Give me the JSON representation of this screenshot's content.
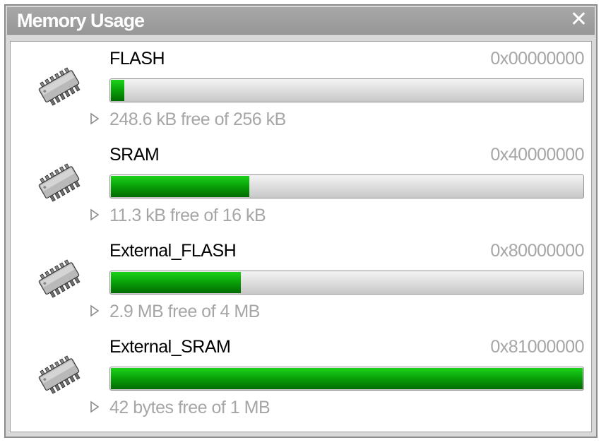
{
  "window": {
    "title": "Memory Usage",
    "close_glyph": "✕"
  },
  "memories": [
    {
      "name": "FLASH",
      "address": "0x00000000",
      "free_text": "248.6 kB free of 256 kB",
      "used_fraction": 0.029,
      "icon": "memory-chip-icon"
    },
    {
      "name": "SRAM",
      "address": "0x40000000",
      "free_text": "11.3 kB free of 16 kB",
      "used_fraction": 0.294,
      "icon": "memory-chip-icon"
    },
    {
      "name": "External_FLASH",
      "address": "0x80000000",
      "free_text": "2.9 MB free of 4 MB",
      "used_fraction": 0.275,
      "icon": "memory-chip-icon"
    },
    {
      "name": "External_SRAM",
      "address": "0x81000000",
      "free_text": "42 bytes free of 1 MB",
      "used_fraction": 1.0,
      "icon": "memory-chip-icon"
    }
  ],
  "colors": {
    "bar_fill": "#0aa40a",
    "bar_track": "#e0e0e0",
    "title_bar": "#a0a0a0",
    "muted_text": "#a6a6a6"
  }
}
